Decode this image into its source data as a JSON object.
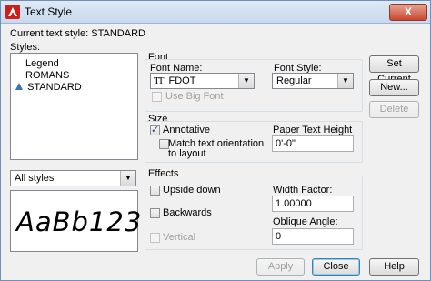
{
  "window": {
    "title": "Text Style",
    "close_glyph": "X"
  },
  "current_style": {
    "label": "Current text style:",
    "value": "STANDARD"
  },
  "styles": {
    "label": "Styles:",
    "items": [
      {
        "label": "Legend"
      },
      {
        "label": "ROMANS"
      },
      {
        "label": "STANDARD",
        "icon": "annotative-triangle-icon"
      }
    ],
    "filter_value": "All styles"
  },
  "preview": {
    "text": "AaBb123"
  },
  "font": {
    "group_label": "Font",
    "font_name_label": "Font Name:",
    "font_name_value": "FDOT",
    "font_name_icon": "truetype-font-icon",
    "font_style_label": "Font Style:",
    "font_style_value": "Regular",
    "use_big_font_label": "Use Big Font",
    "use_big_font_checked": false
  },
  "size": {
    "group_label": "Size",
    "annotative_label": "Annotative",
    "annotative_checked": true,
    "match_orientation_label_1": "Match text orientation",
    "match_orientation_label_2": "to layout",
    "match_orientation_checked": false,
    "paper_height_label": "Paper Text Height",
    "paper_height_value": "0'-0\""
  },
  "effects": {
    "group_label": "Effects",
    "upside_down_label": "Upside down",
    "backwards_label": "Backwards",
    "vertical_label": "Vertical",
    "width_factor_label": "Width Factor:",
    "width_factor_value": "1.00000",
    "oblique_angle_label": "Oblique Angle:",
    "oblique_angle_value": "0"
  },
  "buttons": {
    "set_current": "Set Current",
    "new": "New...",
    "delete": "Delete",
    "apply": "Apply",
    "close": "Close",
    "help": "Help"
  },
  "colors": {
    "title_bar": "#c9d9ee",
    "close_button": "#c9472f",
    "selection_icon": "#3a6fc4"
  }
}
